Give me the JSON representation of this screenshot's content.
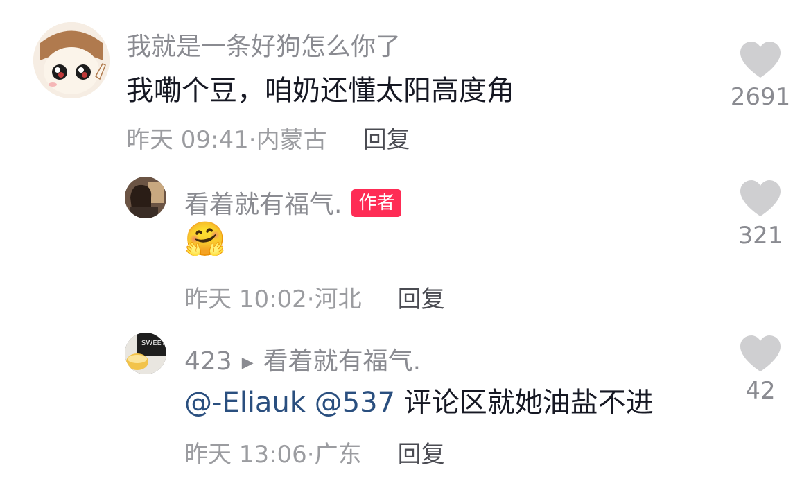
{
  "comments": [
    {
      "username": "我就是一条好狗怎么你了",
      "text": "我嘞个豆，咱奶还懂太阳高度角",
      "time": "昨天 09:41",
      "location": "内蒙古",
      "reply_label": "回复",
      "likes": "2691"
    },
    {
      "username": "看着就有福气.",
      "badge": "作者",
      "text": "🤗",
      "time": "昨天 10:02",
      "location": "河北",
      "reply_label": "回复",
      "likes": "321"
    },
    {
      "username": "423",
      "arrow": "▶",
      "reply_to": "看着就有福气.",
      "mention1": "@-Eliauk",
      "mention2": "@537",
      "text": "评论区就她油盐不进",
      "time": "昨天 13:06",
      "location": "广东",
      "reply_label": "回复",
      "likes": "42"
    }
  ],
  "separator": "·",
  "colors": {
    "badge": "#fe2c55",
    "mention": "#2a4f7f",
    "like_icon": "#cfcfd1"
  }
}
